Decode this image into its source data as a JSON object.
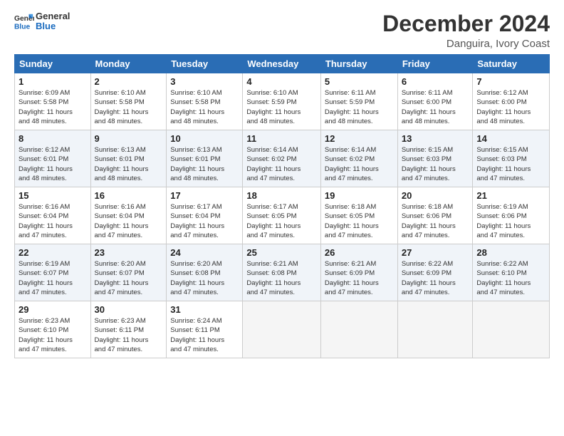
{
  "header": {
    "logo_line1": "General",
    "logo_line2": "Blue",
    "month": "December 2024",
    "location": "Danguira, Ivory Coast"
  },
  "weekdays": [
    "Sunday",
    "Monday",
    "Tuesday",
    "Wednesday",
    "Thursday",
    "Friday",
    "Saturday"
  ],
  "weeks": [
    [
      {
        "day": "1",
        "info": "Sunrise: 6:09 AM\nSunset: 5:58 PM\nDaylight: 11 hours\nand 48 minutes."
      },
      {
        "day": "2",
        "info": "Sunrise: 6:10 AM\nSunset: 5:58 PM\nDaylight: 11 hours\nand 48 minutes."
      },
      {
        "day": "3",
        "info": "Sunrise: 6:10 AM\nSunset: 5:58 PM\nDaylight: 11 hours\nand 48 minutes."
      },
      {
        "day": "4",
        "info": "Sunrise: 6:10 AM\nSunset: 5:59 PM\nDaylight: 11 hours\nand 48 minutes."
      },
      {
        "day": "5",
        "info": "Sunrise: 6:11 AM\nSunset: 5:59 PM\nDaylight: 11 hours\nand 48 minutes."
      },
      {
        "day": "6",
        "info": "Sunrise: 6:11 AM\nSunset: 6:00 PM\nDaylight: 11 hours\nand 48 minutes."
      },
      {
        "day": "7",
        "info": "Sunrise: 6:12 AM\nSunset: 6:00 PM\nDaylight: 11 hours\nand 48 minutes."
      }
    ],
    [
      {
        "day": "8",
        "info": "Sunrise: 6:12 AM\nSunset: 6:01 PM\nDaylight: 11 hours\nand 48 minutes."
      },
      {
        "day": "9",
        "info": "Sunrise: 6:13 AM\nSunset: 6:01 PM\nDaylight: 11 hours\nand 48 minutes."
      },
      {
        "day": "10",
        "info": "Sunrise: 6:13 AM\nSunset: 6:01 PM\nDaylight: 11 hours\nand 48 minutes."
      },
      {
        "day": "11",
        "info": "Sunrise: 6:14 AM\nSunset: 6:02 PM\nDaylight: 11 hours\nand 47 minutes."
      },
      {
        "day": "12",
        "info": "Sunrise: 6:14 AM\nSunset: 6:02 PM\nDaylight: 11 hours\nand 47 minutes."
      },
      {
        "day": "13",
        "info": "Sunrise: 6:15 AM\nSunset: 6:03 PM\nDaylight: 11 hours\nand 47 minutes."
      },
      {
        "day": "14",
        "info": "Sunrise: 6:15 AM\nSunset: 6:03 PM\nDaylight: 11 hours\nand 47 minutes."
      }
    ],
    [
      {
        "day": "15",
        "info": "Sunrise: 6:16 AM\nSunset: 6:04 PM\nDaylight: 11 hours\nand 47 minutes."
      },
      {
        "day": "16",
        "info": "Sunrise: 6:16 AM\nSunset: 6:04 PM\nDaylight: 11 hours\nand 47 minutes."
      },
      {
        "day": "17",
        "info": "Sunrise: 6:17 AM\nSunset: 6:04 PM\nDaylight: 11 hours\nand 47 minutes."
      },
      {
        "day": "18",
        "info": "Sunrise: 6:17 AM\nSunset: 6:05 PM\nDaylight: 11 hours\nand 47 minutes."
      },
      {
        "day": "19",
        "info": "Sunrise: 6:18 AM\nSunset: 6:05 PM\nDaylight: 11 hours\nand 47 minutes."
      },
      {
        "day": "20",
        "info": "Sunrise: 6:18 AM\nSunset: 6:06 PM\nDaylight: 11 hours\nand 47 minutes."
      },
      {
        "day": "21",
        "info": "Sunrise: 6:19 AM\nSunset: 6:06 PM\nDaylight: 11 hours\nand 47 minutes."
      }
    ],
    [
      {
        "day": "22",
        "info": "Sunrise: 6:19 AM\nSunset: 6:07 PM\nDaylight: 11 hours\nand 47 minutes."
      },
      {
        "day": "23",
        "info": "Sunrise: 6:20 AM\nSunset: 6:07 PM\nDaylight: 11 hours\nand 47 minutes."
      },
      {
        "day": "24",
        "info": "Sunrise: 6:20 AM\nSunset: 6:08 PM\nDaylight: 11 hours\nand 47 minutes."
      },
      {
        "day": "25",
        "info": "Sunrise: 6:21 AM\nSunset: 6:08 PM\nDaylight: 11 hours\nand 47 minutes."
      },
      {
        "day": "26",
        "info": "Sunrise: 6:21 AM\nSunset: 6:09 PM\nDaylight: 11 hours\nand 47 minutes."
      },
      {
        "day": "27",
        "info": "Sunrise: 6:22 AM\nSunset: 6:09 PM\nDaylight: 11 hours\nand 47 minutes."
      },
      {
        "day": "28",
        "info": "Sunrise: 6:22 AM\nSunset: 6:10 PM\nDaylight: 11 hours\nand 47 minutes."
      }
    ],
    [
      {
        "day": "29",
        "info": "Sunrise: 6:23 AM\nSunset: 6:10 PM\nDaylight: 11 hours\nand 47 minutes."
      },
      {
        "day": "30",
        "info": "Sunrise: 6:23 AM\nSunset: 6:11 PM\nDaylight: 11 hours\nand 47 minutes."
      },
      {
        "day": "31",
        "info": "Sunrise: 6:24 AM\nSunset: 6:11 PM\nDaylight: 11 hours\nand 47 minutes."
      },
      null,
      null,
      null,
      null
    ]
  ]
}
